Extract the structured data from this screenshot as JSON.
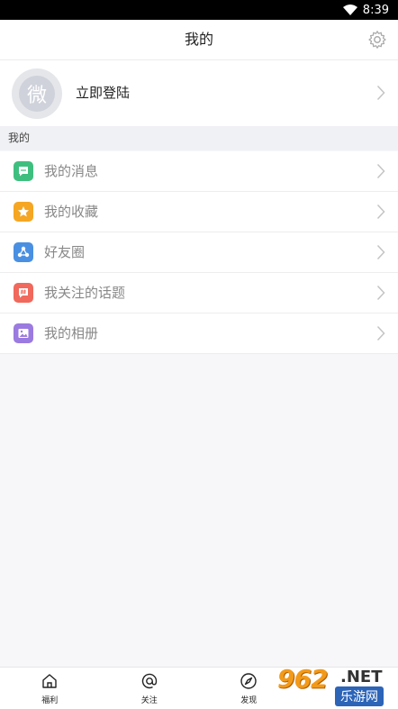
{
  "status_bar": {
    "time": "8:39"
  },
  "header": {
    "title": "我的"
  },
  "profile": {
    "avatar_char": "微",
    "login_label": "立即登陆"
  },
  "section": {
    "title": "我的"
  },
  "menu": {
    "items": [
      {
        "label": "我的消息",
        "icon": "message-icon",
        "color": "#3fbf7f"
      },
      {
        "label": "我的收藏",
        "icon": "star-icon",
        "color": "#f5a623"
      },
      {
        "label": "好友圈",
        "icon": "friends-circle-icon",
        "color": "#4a90e2"
      },
      {
        "label": "我关注的话题",
        "icon": "topic-icon",
        "color": "#f0695c"
      },
      {
        "label": "我的相册",
        "icon": "album-icon",
        "color": "#9b7be0"
      }
    ]
  },
  "tabs": [
    {
      "label": "福利",
      "icon": "home-icon"
    },
    {
      "label": "关注",
      "icon": "at-icon"
    },
    {
      "label": "发现",
      "icon": "compass-icon"
    },
    {
      "label": "",
      "icon": ""
    }
  ],
  "watermark": {
    "number": "962",
    "net": ".NET",
    "cn": "乐游网"
  }
}
